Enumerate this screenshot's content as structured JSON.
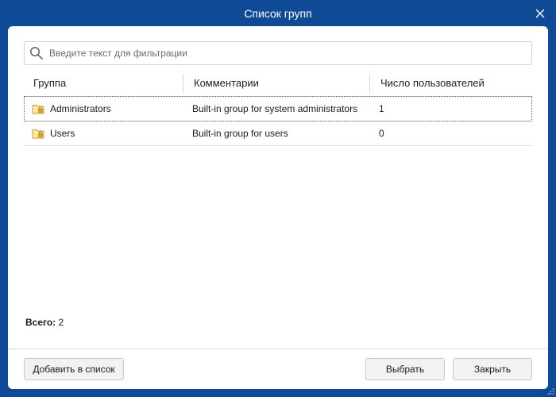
{
  "window": {
    "title": "Список групп",
    "close_icon": "close-icon"
  },
  "search": {
    "placeholder": "Введите текст для фильтрации",
    "value": "",
    "icon": "search-icon"
  },
  "table": {
    "columns": [
      "Группа",
      "Комментарии",
      "Число пользователей"
    ],
    "rows": [
      {
        "name": "Administrators",
        "comment": "Built-in group for system administrators",
        "count": "1",
        "icon": "group-folder-icon"
      },
      {
        "name": "Users",
        "comment": "Built-in group for users",
        "count": "0",
        "icon": "group-folder-icon"
      }
    ]
  },
  "summary": {
    "total_label": "Всего:",
    "total_value": "2"
  },
  "buttons": {
    "add": "Добавить в список",
    "select": "Выбрать",
    "close": "Закрыть"
  },
  "colors": {
    "window_bg": "#0f4a96",
    "panel_bg": "#ffffff",
    "folder": "#e8b84a"
  }
}
